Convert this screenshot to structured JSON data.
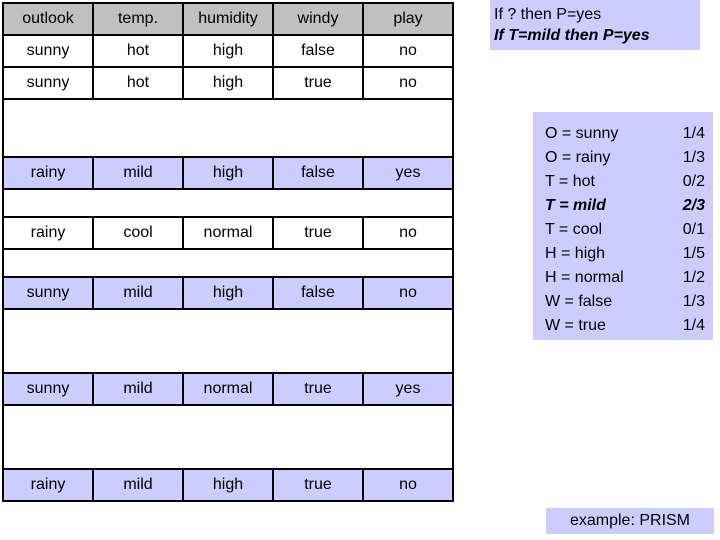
{
  "table": {
    "columns": [
      "outlook",
      "temp.",
      "humidity",
      "windy",
      "play"
    ],
    "rows": [
      {
        "kind": "data",
        "highlight": false,
        "cells": [
          "sunny",
          "hot",
          "high",
          "false",
          "no"
        ]
      },
      {
        "kind": "data",
        "highlight": false,
        "cells": [
          "sunny",
          "hot",
          "high",
          "true",
          "no"
        ]
      },
      {
        "kind": "spacer",
        "height": "tall",
        "cells": [
          "",
          "",
          "",
          "",
          ""
        ]
      },
      {
        "kind": "data",
        "highlight": true,
        "cells": [
          "rainy",
          "mild",
          "high",
          "false",
          "yes"
        ]
      },
      {
        "kind": "spacer",
        "height": "normal",
        "cells": [
          "",
          "",
          "",
          "",
          ""
        ]
      },
      {
        "kind": "data",
        "highlight": false,
        "cells": [
          "rainy",
          "cool",
          "normal",
          "true",
          "no"
        ]
      },
      {
        "kind": "spacer",
        "height": "normal",
        "cells": [
          "",
          "",
          "",
          "",
          ""
        ]
      },
      {
        "kind": "data",
        "highlight": true,
        "cells": [
          "sunny",
          "mild",
          "high",
          "false",
          "no"
        ]
      },
      {
        "kind": "spacer",
        "height": "xtall",
        "cells": [
          "",
          "",
          "",
          "",
          ""
        ]
      },
      {
        "kind": "data",
        "highlight": true,
        "cells": [
          "sunny",
          "mild",
          "normal",
          "true",
          "yes"
        ]
      },
      {
        "kind": "spacer",
        "height": "xtall",
        "cells": [
          "",
          "",
          "",
          "",
          ""
        ]
      },
      {
        "kind": "data",
        "highlight": true,
        "cells": [
          "rainy",
          "mild",
          "high",
          "true",
          "no"
        ]
      }
    ]
  },
  "rule_box": {
    "lines": [
      {
        "text": "If ? then P=yes",
        "emphasis": false
      },
      {
        "text": "If T=mild then P=yes",
        "emphasis": true
      }
    ]
  },
  "coverage_box": {
    "rows": [
      {
        "label": "O = sunny",
        "value": "1/4",
        "emphasis": false
      },
      {
        "label": "O = rainy",
        "value": "1/3",
        "emphasis": false
      },
      {
        "label": "T = hot",
        "value": "0/2",
        "emphasis": false
      },
      {
        "label": "T = mild",
        "value": "2/3",
        "emphasis": true
      },
      {
        "label": "T = cool",
        "value": "0/1",
        "emphasis": false
      },
      {
        "label": "H = high",
        "value": "1/5",
        "emphasis": false
      },
      {
        "label": "H = normal",
        "value": "1/2",
        "emphasis": false
      },
      {
        "label": "W = false",
        "value": "1/3",
        "emphasis": false
      },
      {
        "label": "W = true",
        "value": "1/4",
        "emphasis": false
      }
    ]
  },
  "caption": {
    "text": "example: PRISM"
  },
  "colors": {
    "highlight": "#ccccff",
    "header": "#c0c0c0",
    "border": "#000000",
    "text": "#000000",
    "background": "#ffffff"
  }
}
